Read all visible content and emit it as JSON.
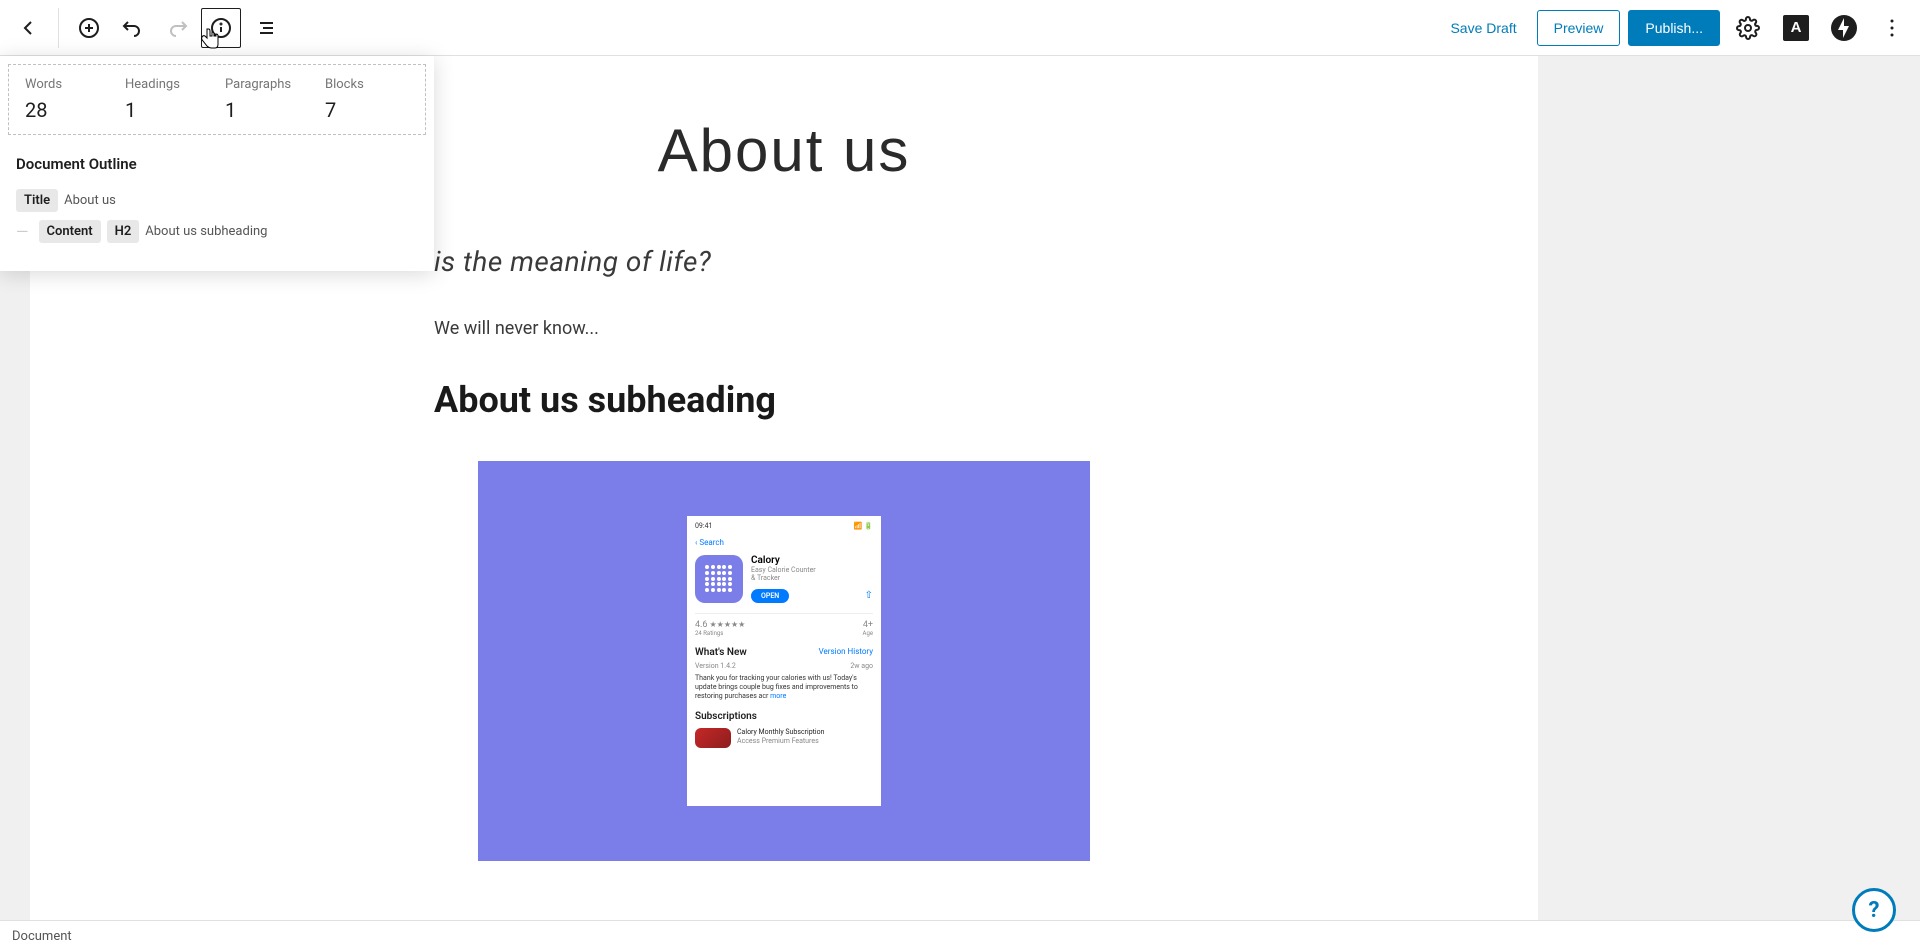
{
  "toolbar": {
    "save_draft": "Save Draft",
    "preview": "Preview",
    "publish": "Publish...",
    "a_icon": "A"
  },
  "stats": {
    "words_label": "Words",
    "words_value": "28",
    "headings_label": "Headings",
    "headings_value": "1",
    "paragraphs_label": "Paragraphs",
    "paragraphs_value": "1",
    "blocks_label": "Blocks",
    "blocks_value": "7"
  },
  "outline": {
    "heading": "Document Outline",
    "title_badge": "Title",
    "title_text": "About us",
    "content_badge": "Content",
    "h2_badge": "H2",
    "h2_text": "About us subheading"
  },
  "post": {
    "title": "About us",
    "quote": "is the meaning of life?",
    "paragraph": "We will never know...",
    "subheading": "About us subheading"
  },
  "phone": {
    "time": "09:41",
    "search": "Search",
    "app_name": "Calory",
    "app_desc1": "Easy Calorie Counter",
    "app_desc2": "& Tracker",
    "open": "OPEN",
    "rating": "4.6",
    "stars": "★★★★★",
    "ratings_count": "24 Ratings",
    "age": "4+",
    "age_label": "Age",
    "whats_new": "What's New",
    "version_history": "Version History",
    "version": "Version 1.4.2",
    "time_ago": "2w ago",
    "update_text": "Thank you for tracking your calories with us! Today's update brings couple bug fixes and improvements to restoring purchases acr",
    "more": "more",
    "subscriptions": "Subscriptions",
    "sub_name": "Calory Monthly Subscription",
    "sub_desc": "Access Premium Features"
  },
  "bottom": {
    "document": "Document"
  },
  "help": "?",
  "colors": {
    "primary": "#007cba",
    "image_bg": "#7b7de8"
  }
}
